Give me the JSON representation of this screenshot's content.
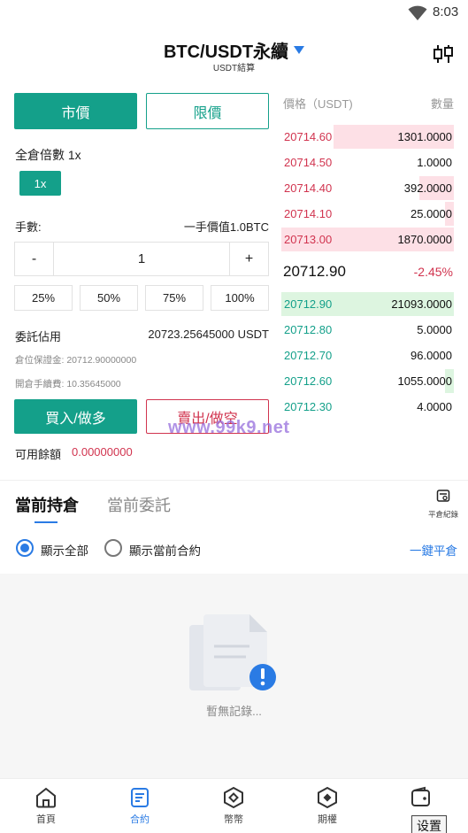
{
  "status_bar": {
    "time": "8:03"
  },
  "header": {
    "title": "BTC/USDT永續",
    "subtitle": "USDT結算"
  },
  "order_type": {
    "market": "市價",
    "limit": "限價"
  },
  "leverage": {
    "label": "全倉倍數 1x",
    "chip": "1x"
  },
  "quantity": {
    "label": "手數:",
    "unit_value": "一手價值1.0BTC",
    "minus": "-",
    "plus": "+",
    "value": "1"
  },
  "percent_buttons": [
    "25%",
    "50%",
    "75%",
    "100%"
  ],
  "margin": {
    "label": "委託佔用",
    "value": "20723.25645000 USDT",
    "position_margin": "倉位保證金: 20712.90000000",
    "open_fee": "開倉手續費: 10.35645000"
  },
  "actions": {
    "buy": "買入/做多",
    "sell": "賣出/做空"
  },
  "available": {
    "label": "可用餘額",
    "value": "0.00000000"
  },
  "orderbook": {
    "price_header": "價格（USDT)",
    "amount_header": "數量",
    "asks": [
      {
        "price": "20714.60",
        "amount": "1301.0000",
        "depth": 0.7
      },
      {
        "price": "20714.50",
        "amount": "1.0000",
        "depth": 0.0
      },
      {
        "price": "20714.40",
        "amount": "392.0000",
        "depth": 0.2
      },
      {
        "price": "20714.10",
        "amount": "25.0000",
        "depth": 0.05
      },
      {
        "price": "20713.00",
        "amount": "1870.0000",
        "depth": 1.0
      }
    ],
    "last_price": "20712.90",
    "change": "-2.45%",
    "bids": [
      {
        "price": "20712.90",
        "amount": "21093.0000",
        "depth": 1.0
      },
      {
        "price": "20712.80",
        "amount": "5.0000",
        "depth": 0.0
      },
      {
        "price": "20712.70",
        "amount": "96.0000",
        "depth": 0.0
      },
      {
        "price": "20712.60",
        "amount": "1055.0000",
        "depth": 0.05
      },
      {
        "price": "20712.30",
        "amount": "4.0000",
        "depth": 0.0
      }
    ]
  },
  "watermark": "www.99k9.net",
  "positions": {
    "tab_current": "當前持倉",
    "tab_orders": "當前委託",
    "history": "平倉紀錄",
    "show_all": "顯示全部",
    "show_current": "顯示當前合約",
    "close_all": "一鍵平倉",
    "empty": "暫無記錄..."
  },
  "nav": {
    "items": [
      {
        "label": "首頁",
        "icon": "home-icon"
      },
      {
        "label": "合約",
        "icon": "contract-icon"
      },
      {
        "label": "幣幣",
        "icon": "coin-icon"
      },
      {
        "label": "期權",
        "icon": "options-icon"
      },
      {
        "label": "",
        "icon": "wallet-icon"
      }
    ],
    "tooltip": "设置"
  },
  "colors": {
    "green": "#14a08a",
    "red": "#d1344f",
    "blue": "#2a7be4"
  }
}
